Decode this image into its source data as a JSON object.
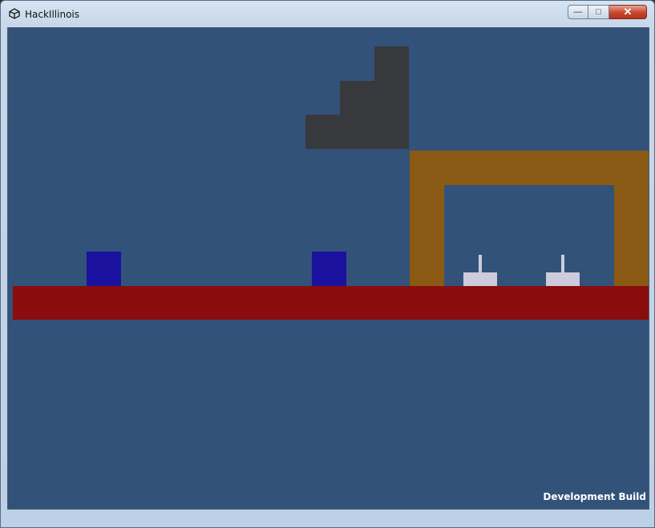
{
  "window": {
    "title": "HackIllinois",
    "controls": {
      "minimize_glyph": "—",
      "maximize_glyph": "□",
      "close_glyph": "✕"
    },
    "icons": {
      "app": "unity-logo-icon"
    }
  },
  "game": {
    "background_color": "#32527a",
    "overlay_text": "Development Build",
    "colors": {
      "stairs": "#38393d",
      "arch": "#8a5a14",
      "floor": "#8a0c0d",
      "blocks": "#1b12a0",
      "levers": "#ccccdc"
    }
  }
}
